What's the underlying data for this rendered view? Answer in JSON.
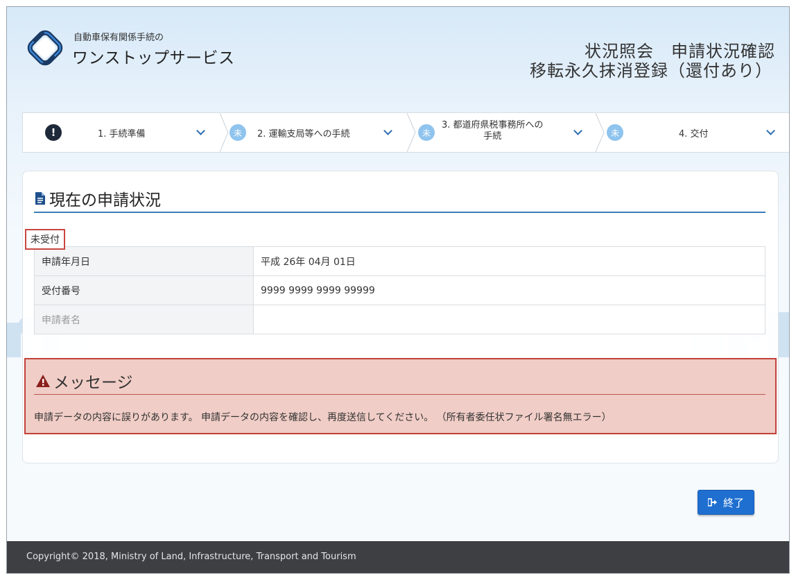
{
  "header": {
    "logo_sub": "自動車保有関係手続の",
    "logo_main": "ワンストップサービス",
    "title_line1": "状況照会　申請状況確認",
    "title_line2": "移転永久抹消登録（還付あり）"
  },
  "steps": [
    {
      "label": "1. 手続準備",
      "status_icon": "alert-icon",
      "status_text": "!"
    },
    {
      "label": "2. 運輸支局等への手続",
      "status_icon": "pending-icon",
      "status_text": "未"
    },
    {
      "label_line1": "3. 都道府県税事務所への",
      "label_line2": "手続",
      "status_icon": "pending-icon",
      "status_text": "未"
    },
    {
      "label": "4. 交付",
      "status_icon": "pending-icon",
      "status_text": "未"
    }
  ],
  "main": {
    "section_title": "現在の申請状況",
    "status": "未受付",
    "rows": [
      {
        "key": "申請年月日",
        "value": "平成 26年 04月 01日"
      },
      {
        "key": "受付番号",
        "value": "9999 9999 9999 99999"
      },
      {
        "key": "申請者名",
        "value": ""
      }
    ]
  },
  "message": {
    "title": "メッセージ",
    "text": "申請データの内容に誤りがあります。 申請データの内容を確認し、再度送信してください。 （所有者委任状ファイル署名無エラー）"
  },
  "finish_button": "終了",
  "footer": "Copyright© 2018, Ministry of Land, Infrastructure, Transport and Tourism",
  "colors": {
    "accent": "#1f6fd1",
    "error_border": "#c0413a",
    "error_bg": "#f0cdc6",
    "pending": "#8fc4ee",
    "footer_bg": "#3d3f43"
  }
}
